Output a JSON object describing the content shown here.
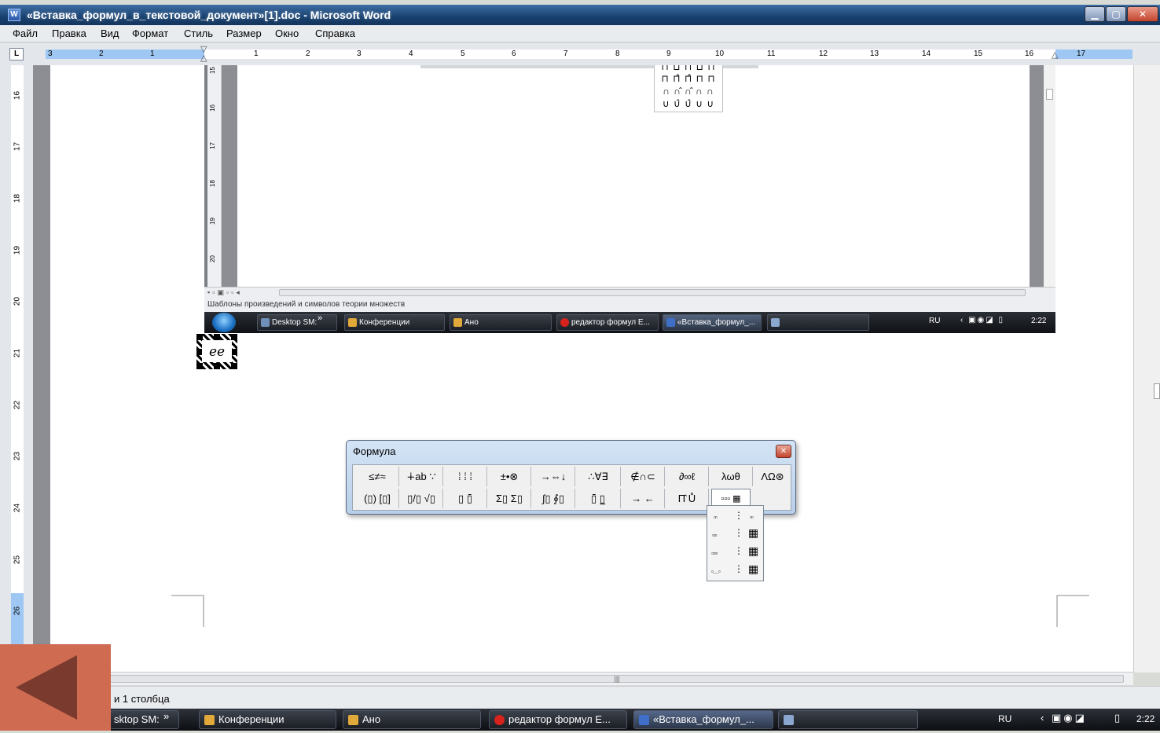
{
  "window": {
    "title": "«Вставка_формул_в_текстовой_документ»[1].doc - Microsoft Word",
    "min_glyph": "▁",
    "max_glyph": "▢",
    "close_glyph": "✕"
  },
  "menu": [
    "Файл",
    "Правка",
    "Вид",
    "Формат",
    "Стиль",
    "Размер",
    "Окно",
    "Справка"
  ],
  "ruler": {
    "tab_selector": "L",
    "left_numbers": [
      "3",
      "2",
      "1"
    ],
    "right_numbers": [
      "1",
      "2",
      "3",
      "4",
      "5",
      "6",
      "7",
      "8",
      "9",
      "10",
      "11",
      "12",
      "13",
      "14",
      "15",
      "16",
      "17"
    ],
    "vertical_numbers": [
      "16",
      "17",
      "18",
      "19",
      "20",
      "21",
      "22",
      "23",
      "24",
      "25",
      "26"
    ]
  },
  "embedded": {
    "vertical_numbers": [
      "15",
      "16",
      "17",
      "18",
      "19",
      "20"
    ],
    "symbol_rows": [
      "⊓ ⊔ ⊓̂ ⊔ ⊓",
      "⊓ ⊓̂ ⊓̂ ⊓ ⊓",
      "∩ ∩̂ ∩̂ ∩ ∩",
      "∪ ∪̂ ∪̂ ∪ ∪"
    ],
    "status_text": "Шаблоны произведений и символов теории множеств",
    "taskbar": {
      "tasks": [
        "Desktop SM:",
        "Конференции",
        "Ано",
        "редактор формул E...",
        "«Вставка_формул_..."
      ],
      "overflow": "»",
      "lang": "RU",
      "time": "2:22"
    }
  },
  "equation_object": {
    "text": "ee"
  },
  "formula_toolbar": {
    "title": "Формула",
    "close_glyph": "✕",
    "row1": [
      "≤≠≈",
      "∔ab ∵",
      "⁞ ⁞ ⁞",
      "±•⊗",
      "→⇔↓",
      "∴∀∃",
      "∉∩⊂",
      "∂∞ℓ",
      "λωθ",
      "ΛΩ⊛"
    ],
    "row2": [
      "(▯) [▯]",
      "▯/▯ √▯",
      "▯ ▯̄",
      "Σ▯ Σ▯",
      "∫▯ ∮▯",
      "▯̄ ▯̲",
      "→ ←",
      "Π̂ Ů"
    ],
    "matrix_button": "▫▫▫ ▦",
    "matrix_palette": [
      "▫▫",
      "⋮",
      "▫▫",
      "▫▫▫",
      "⋮",
      "▦",
      "▫▫▫▫",
      "⋮",
      "▦",
      "▫…▫",
      "⋮",
      "▦"
    ]
  },
  "statusbar": {
    "text": "и 1 столбца"
  },
  "taskbar": {
    "tasks": [
      "sktop SM:",
      "Конференции",
      "Ано",
      "редактор формул E...",
      "«Вставка_формул_..."
    ],
    "overflow": "»",
    "lang": "RU",
    "time": "2:22"
  },
  "colors": {
    "back_button": "#cf6b51",
    "back_arrow": "#7b3a2e",
    "titlebar": "#17406f",
    "ruler_blue": "#9ec7f3"
  },
  "icons": {
    "back": "triangle-left-icon",
    "start": "windows-orb-icon"
  }
}
